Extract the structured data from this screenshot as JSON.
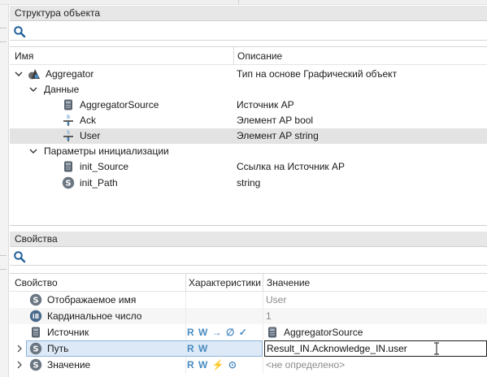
{
  "structure_panel": {
    "title": "Структура объекта",
    "search": {
      "placeholder": "",
      "value": ""
    },
    "columns": {
      "name": "Имя",
      "description": "Описание"
    },
    "rows": [
      {
        "name": "Aggregator",
        "description": "Тип на основе Графический объект",
        "icon": "aggregator-icon",
        "expanded": true
      },
      {
        "name": "Данные",
        "description": "",
        "icon": "",
        "expanded": true
      },
      {
        "name": "AggregatorSource",
        "description": "Источник AP",
        "icon": "source-icon"
      },
      {
        "name": "Ack",
        "description": "Элемент AP bool",
        "icon": "bool-element-icon"
      },
      {
        "name": "User",
        "description": "Элемент AP string",
        "icon": "string-element-icon",
        "selected": true
      },
      {
        "name": "Параметры инициализации",
        "description": "",
        "icon": "",
        "expanded": true
      },
      {
        "name": "init_Source",
        "description": "Ссылка на Источник AP",
        "icon": "source-icon"
      },
      {
        "name": "init_Path",
        "description": "string",
        "icon": "string-type-icon"
      }
    ]
  },
  "properties_panel": {
    "title": "Свойства",
    "search": {
      "placeholder": "",
      "value": ""
    },
    "columns": {
      "property": "Свойство",
      "characteristics": "Характеристики",
      "value": "Значение"
    },
    "rows": [
      {
        "name": "Отображаемое имя",
        "chars": "",
        "value": "User",
        "icon": "string-type-icon"
      },
      {
        "name": "Кардинальное число",
        "chars": "",
        "value": "1",
        "icon": "int8-type-icon"
      },
      {
        "name": "Источник",
        "chars": "R W → ∅ ✓",
        "value": "AggregatorSource",
        "icon": "source-icon"
      },
      {
        "name": "Путь",
        "chars": "R W",
        "value": "Result_IN.Acknowledge_IN.user",
        "icon": "string-type-icon",
        "editing": true
      },
      {
        "name": "Значение",
        "chars": "R W ⚡ ⊙",
        "value": "<не определено>",
        "icon": "string-type-icon"
      }
    ]
  },
  "colors": {
    "accent_blue": "#4a8bc2",
    "selection_gray": "#e3e3e3",
    "edit_selection": "#dde9f6"
  }
}
